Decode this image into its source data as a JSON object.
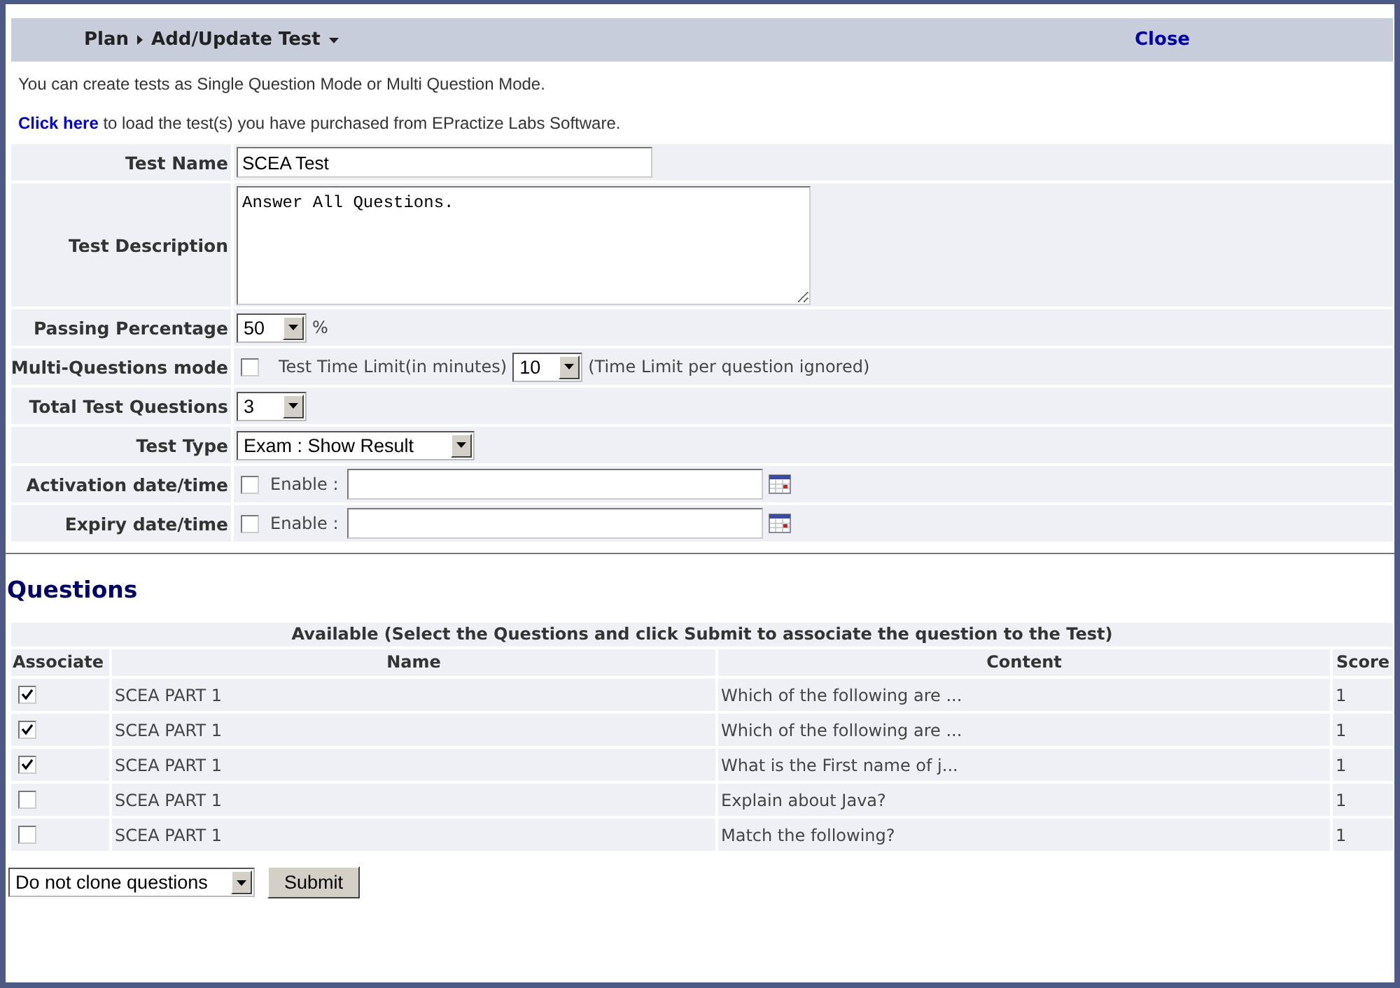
{
  "header": {
    "breadcrumb": "Plan",
    "page": "Add/Update Test",
    "close": "Close"
  },
  "intro": "You can create tests as Single Question Mode or Multi Question Mode.",
  "load_notice": {
    "link": "Click here",
    "text": "to load the test(s) you have purchased from EPractize Labs Software."
  },
  "fields": [
    {
      "kind": "text",
      "label": "Test Name",
      "value": "SCEA Test"
    },
    {
      "kind": "textarea",
      "label": "Test Description",
      "value": "Answer All Questions."
    },
    {
      "kind": "select",
      "label": "Passing Percentage",
      "value": "50",
      "unit": "%"
    },
    {
      "kind": "multi",
      "label": "Multi-Questions mode",
      "checked": false,
      "time_label": "Test Time Limit(in minutes)",
      "time_value": "10",
      "note": "(Time Limit per question ignored)"
    },
    {
      "kind": "select",
      "label": "Total Test Questions",
      "value": "3"
    },
    {
      "kind": "wideselect",
      "label": "Test Type",
      "value": "Exam : Show Result"
    },
    {
      "kind": "date",
      "label": "Activation date/time",
      "checked": false,
      "enable_label": "Enable :"
    },
    {
      "kind": "date",
      "label": "Expiry date/time",
      "checked": false,
      "enable_label": "Enable :"
    }
  ],
  "questions": {
    "heading": "Questions",
    "caption": "Available (Select the Questions and click Submit to associate the question to the Test)",
    "columns": [
      "Associate",
      "Name",
      "Content",
      "Score"
    ],
    "rows": [
      {
        "associate": true,
        "name": "SCEA PART 1",
        "content": "Which of the following are ...",
        "score": "1"
      },
      {
        "associate": true,
        "name": "SCEA PART 1",
        "content": "Which of the following are ...",
        "score": "1"
      },
      {
        "associate": true,
        "name": "SCEA PART 1",
        "content": "What is the First name of j...",
        "score": "1"
      },
      {
        "associate": false,
        "name": "SCEA PART 1",
        "content": "Explain about Java?",
        "score": "1"
      },
      {
        "associate": false,
        "name": "SCEA PART 1",
        "content": "Match the following?",
        "score": "1"
      }
    ]
  },
  "clone_select": "Do not clone questions",
  "submit": "Submit"
}
